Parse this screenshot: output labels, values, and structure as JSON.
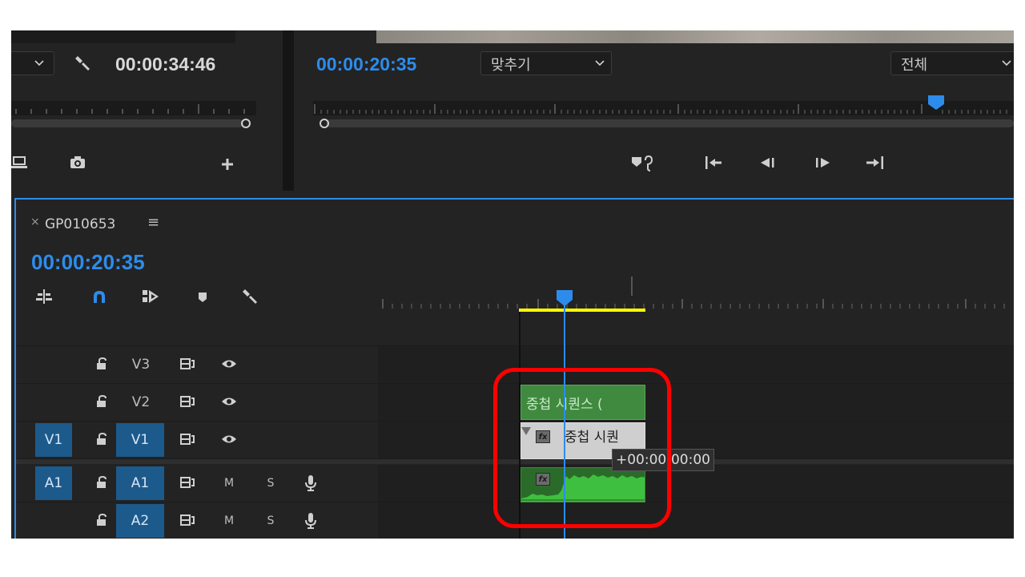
{
  "source_monitor": {
    "timecode": "00:00:34:46",
    "icons": [
      "chevron-down-icon",
      "wrench-icon",
      "export-frame-icon",
      "camera-icon",
      "add-icon"
    ]
  },
  "program_monitor": {
    "timecode": "00:00:20:35",
    "fit_dropdown": "맞추기",
    "resolution_dropdown": "전체",
    "controls": [
      "marker-link-icon",
      "go-to-in-icon",
      "step-back-icon",
      "step-forward-icon",
      "go-to-out-icon"
    ]
  },
  "timeline": {
    "close_symbol": "×",
    "sequence_name": "GP010653",
    "menu_symbol": "≡",
    "timecode": "00:00:20:35",
    "tools": [
      "insert-sequence-icon",
      "snap-magnet-icon",
      "linked-selection-icon",
      "add-marker-icon",
      "wrench-icon"
    ],
    "tracks": [
      {
        "name": "V3",
        "source": "",
        "type": "video"
      },
      {
        "name": "V2",
        "source": "",
        "type": "video"
      },
      {
        "name": "V1",
        "source": "V1",
        "type": "video"
      },
      {
        "name": "A1",
        "source": "A1",
        "type": "audio",
        "m": "M",
        "s": "S"
      },
      {
        "name": "A2",
        "source": "",
        "type": "audio",
        "m": "M",
        "s": "S"
      }
    ],
    "clips": {
      "v2_label": "중첩 시퀀스 (",
      "v1_label": "중첩 시퀀",
      "fx_label": "fx"
    },
    "tooltip": "+00:00:00:00",
    "colors": {
      "accent": "#2d8ceb",
      "work_area": "#ffff00",
      "video_clip": "#3f8a3f",
      "audio_clip": "#2a9a2a",
      "highlight": "#ff0000"
    }
  }
}
